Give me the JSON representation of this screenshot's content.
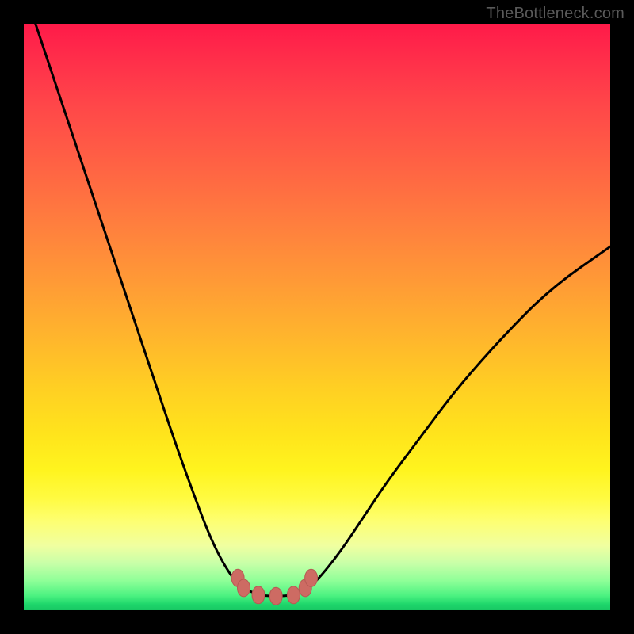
{
  "watermark": "TheBottleneck.com",
  "colors": {
    "frame": "#000000",
    "curve": "#000000",
    "marker_fill": "#cd6b63",
    "marker_stroke": "#b55a53"
  },
  "chart_data": {
    "type": "line",
    "title": "",
    "xlabel": "",
    "ylabel": "",
    "xlim": [
      0,
      100
    ],
    "ylim": [
      0,
      100
    ],
    "grid": false,
    "note": "No numeric axis ticks or labels are rendered in the image; values below are geometric estimates in percent of plot width/height (origin bottom-left).",
    "series": [
      {
        "name": "left-branch",
        "x": [
          2,
          6,
          10,
          14,
          18,
          22,
          26,
          30,
          32,
          34,
          36,
          37,
          38
        ],
        "y": [
          100,
          88,
          76,
          64,
          52,
          40,
          28,
          17,
          12,
          8,
          5,
          4,
          3.5
        ]
      },
      {
        "name": "valley",
        "x": [
          38,
          40,
          42,
          44,
          46,
          48
        ],
        "y": [
          3.5,
          2.6,
          2.4,
          2.4,
          2.6,
          3.5
        ]
      },
      {
        "name": "right-branch",
        "x": [
          48,
          50,
          54,
          58,
          62,
          68,
          74,
          82,
          90,
          100
        ],
        "y": [
          3.5,
          5,
          10,
          16,
          22,
          30,
          38,
          47,
          55,
          62
        ]
      }
    ],
    "markers": {
      "note": "Small salmon-colored nodes clustered at the valley bottom, roughly symmetric.",
      "points": [
        {
          "x": 36.5,
          "y": 5.5
        },
        {
          "x": 37.5,
          "y": 3.8
        },
        {
          "x": 40.0,
          "y": 2.6
        },
        {
          "x": 43.0,
          "y": 2.4
        },
        {
          "x": 46.0,
          "y": 2.6
        },
        {
          "x": 48.0,
          "y": 3.8
        },
        {
          "x": 49.0,
          "y": 5.5
        }
      ]
    }
  }
}
